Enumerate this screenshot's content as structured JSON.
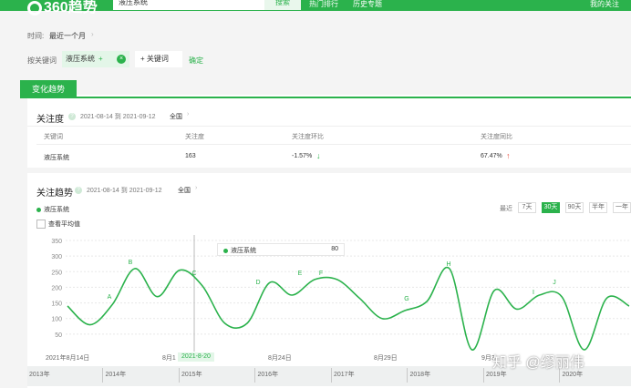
{
  "header": {
    "logo": "360趋势",
    "search_value": "液压系统",
    "search_button": "搜索",
    "links": [
      "热门排行",
      "历史专题"
    ],
    "right_link": "我的关注"
  },
  "filters": {
    "time_label": "时间:",
    "time_value": "最近一个月",
    "keyword_label": "按关键词",
    "keyword_tag": "液压系统",
    "add_keyword": "+ 关键词",
    "confirm": "确定"
  },
  "section_tab": "变化趋势",
  "attention": {
    "title": "关注度",
    "date_range": "2021-08-14 到 2021-09-12",
    "scope": "全国",
    "columns": [
      "关键词",
      "关注度",
      "关注度环比",
      "关注度同比"
    ],
    "row": {
      "keyword": "液压系统",
      "value": "163",
      "mom": "-1.57%",
      "yoy": "67.47%"
    }
  },
  "trend": {
    "title": "关注趋势",
    "date_range": "2021-08-14 到 2021-09-12",
    "scope": "全国",
    "legend": "液压系统",
    "show_avg": "查看平均值",
    "recent_label": "最近",
    "ranges": [
      "7天",
      "30天",
      "90天",
      "半年",
      "一年"
    ],
    "active_range": "30天",
    "tooltip_name": "液压系统",
    "tooltip_value": "80",
    "crosshair_date": "2021-8-20",
    "accent": "#2bb24c"
  },
  "chart_data": {
    "type": "line",
    "ylim": [
      0,
      350
    ],
    "yticks": [
      50,
      100,
      150,
      200,
      250,
      300,
      350
    ],
    "xtick_labels": [
      "2021年8月14日",
      "8月1",
      "8月24日",
      "8月29日",
      "9月3"
    ],
    "annotations": [
      "A",
      "B",
      "C",
      "D",
      "E",
      "F",
      "G",
      "H",
      "I",
      "J"
    ],
    "series": [
      {
        "name": "液压系统",
        "values": [
          140,
          80,
          145,
          260,
          170,
          255,
          205,
          85,
          85,
          215,
          175,
          225,
          225,
          165,
          100,
          125,
          155,
          260,
          0,
          190,
          130,
          175,
          170,
          0,
          165,
          140
        ]
      }
    ]
  },
  "timeline": {
    "years": [
      "2013年",
      "2014年",
      "2015年",
      "2016年",
      "2017年",
      "2018年",
      "2019年",
      "2020年"
    ]
  },
  "watermark": "知乎 @缪丽伟"
}
